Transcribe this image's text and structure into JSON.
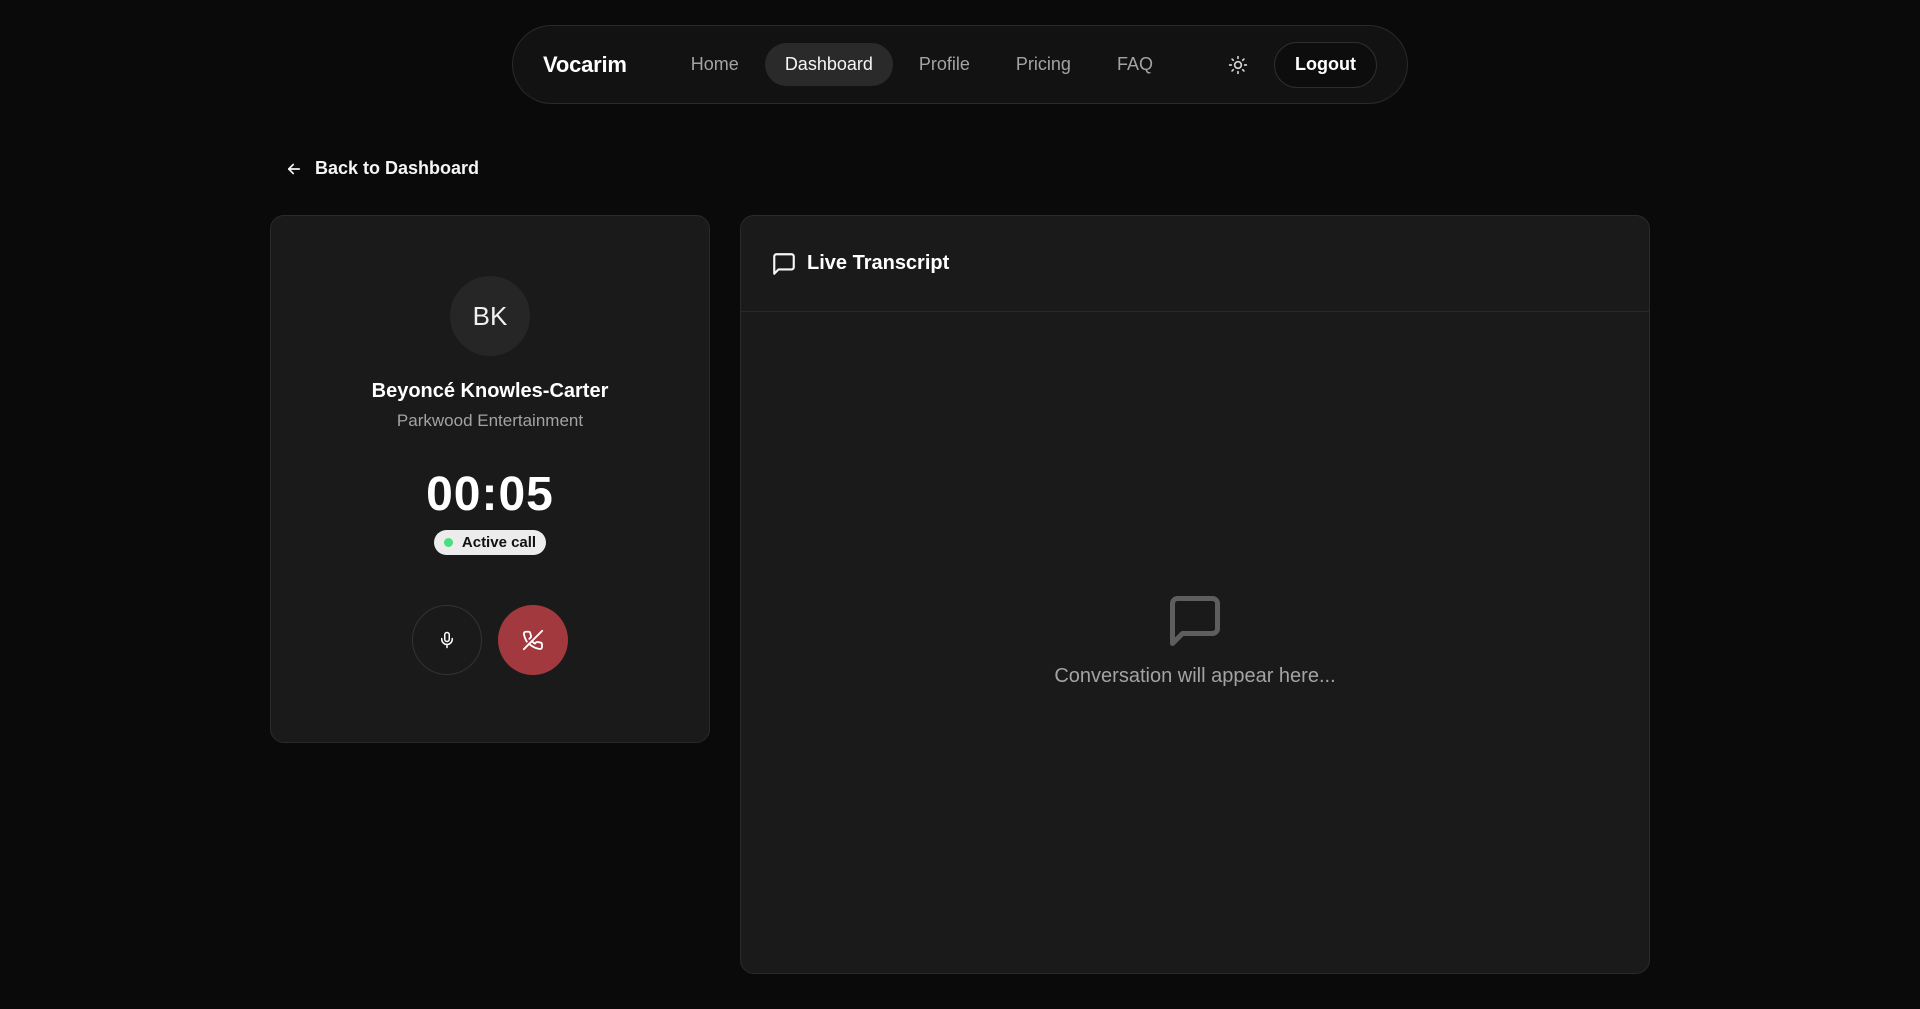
{
  "nav": {
    "brand": "Vocarim",
    "links": [
      {
        "label": "Home",
        "active": false
      },
      {
        "label": "Dashboard",
        "active": true
      },
      {
        "label": "Profile",
        "active": false
      },
      {
        "label": "Pricing",
        "active": false
      },
      {
        "label": "FAQ",
        "active": false
      }
    ],
    "theme_icon": "sun-icon",
    "logout_label": "Logout"
  },
  "back": {
    "icon": "arrow-left-icon",
    "label": "Back to Dashboard"
  },
  "caller": {
    "initials": "BK",
    "name": "Beyoncé Knowles-Carter",
    "company": "Parkwood Entertainment",
    "timer": "00:05",
    "status": "Active call",
    "status_color": "#4ade80",
    "controls": [
      {
        "name": "mic",
        "icon": "microphone-icon"
      },
      {
        "name": "hangup",
        "icon": "phone-off-icon",
        "color": "#a2393f"
      }
    ]
  },
  "transcript": {
    "icon": "message-square-icon",
    "title": "Live Transcript",
    "empty_icon": "message-square-icon",
    "empty_text": "Conversation will appear here..."
  }
}
